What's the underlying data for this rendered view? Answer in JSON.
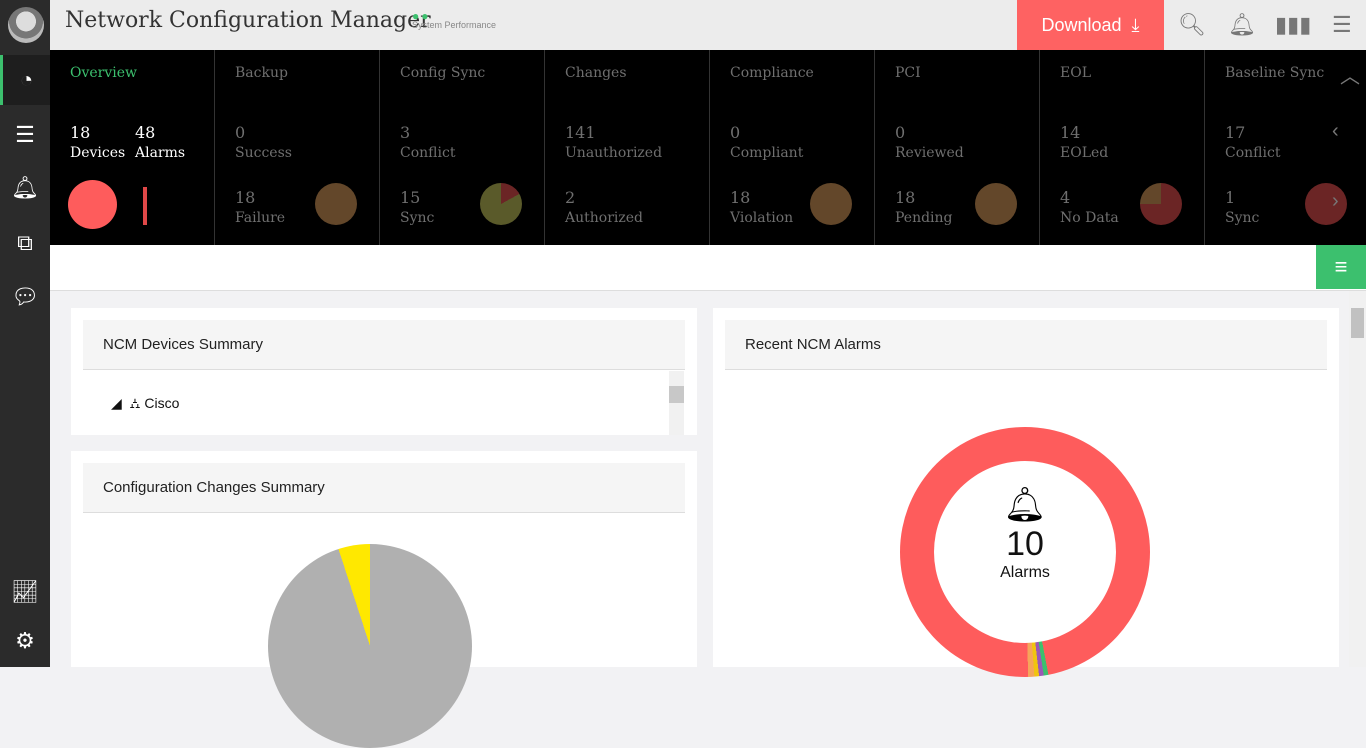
{
  "header": {
    "title": "Network Configuration Manager",
    "perf_label": "System Performance",
    "download_label": "Download"
  },
  "overview": {
    "tab": "Overview",
    "devices_count": "18",
    "devices_label": "Devices",
    "alarms_count": "48",
    "alarms_label": "Alarms"
  },
  "columns": [
    {
      "title": "Backup",
      "n1": "0",
      "l1": "Success",
      "n2": "18",
      "l2": "Failure"
    },
    {
      "title": "Config Sync",
      "n1": "3",
      "l1": "Conflict",
      "n2": "15",
      "l2": "Sync"
    },
    {
      "title": "Changes",
      "n1": "141",
      "l1": "Unauthorized",
      "n2": "2",
      "l2": "Authorized"
    },
    {
      "title": "Compliance",
      "n1": "0",
      "l1": "Compliant",
      "n2": "18",
      "l2": "Violation"
    },
    {
      "title": "PCI",
      "n1": "0",
      "l1": "Reviewed",
      "n2": "18",
      "l2": "Pending"
    },
    {
      "title": "EOL",
      "n1": "14",
      "l1": "EOLed",
      "n2": "4",
      "l2": "No Data"
    },
    {
      "title": "Baseline Sync",
      "n1": "17",
      "l1": "Conflict",
      "n2": "1",
      "l2": "Sync"
    }
  ],
  "panels": {
    "devices_title": "NCM Devices Summary",
    "tree_root": "Cisco",
    "changes_title": "Configuration Changes Summary",
    "alarms_title": "Recent NCM Alarms",
    "alarm_count": "10",
    "alarm_label": "Alarms"
  },
  "colors": {
    "accent": "#3cc06e",
    "download": "#fe6262",
    "alarm": "#fe5c5c"
  }
}
